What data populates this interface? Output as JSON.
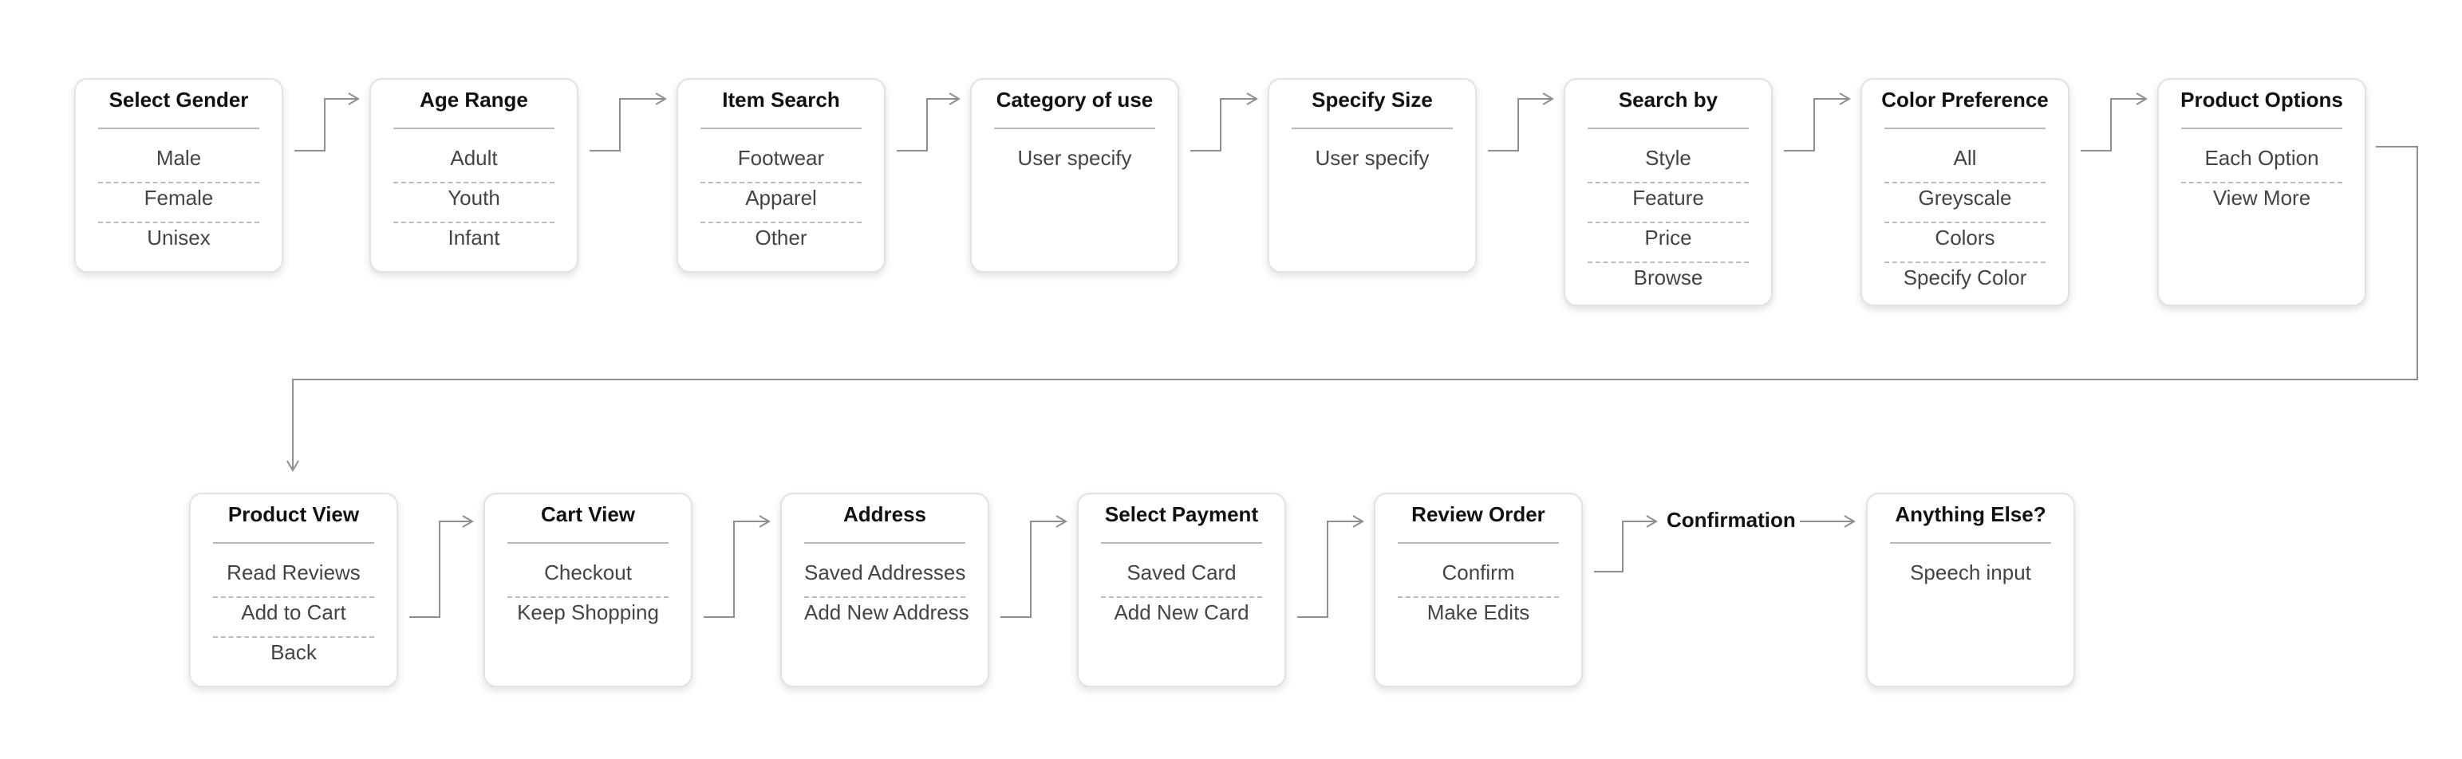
{
  "flow": {
    "row1": [
      {
        "title": "Select Gender",
        "options": [
          "Male",
          "Female",
          "Unisex"
        ]
      },
      {
        "title": "Age Range",
        "options": [
          "Adult",
          "Youth",
          "Infant"
        ]
      },
      {
        "title": "Item Search",
        "options": [
          "Footwear",
          "Apparel",
          "Other"
        ]
      },
      {
        "title": "Category of use",
        "options": [
          "User specify"
        ]
      },
      {
        "title": "Specify Size",
        "options": [
          "User specify"
        ]
      },
      {
        "title": "Search by",
        "options": [
          "Style",
          "Feature",
          "Price",
          "Browse"
        ]
      },
      {
        "title": "Color Preference",
        "options": [
          "All",
          "Greyscale",
          "Colors",
          "Specify Color"
        ]
      },
      {
        "title": "Product Options",
        "options": [
          "Each Option",
          "View More"
        ]
      }
    ],
    "row2": [
      {
        "title": "Product View",
        "options": [
          "Read Reviews",
          "Add to Cart",
          "Back"
        ]
      },
      {
        "title": "Cart View",
        "options": [
          "Checkout",
          "Keep Shopping"
        ]
      },
      {
        "title": "Address",
        "options": [
          "Saved Addresses",
          "Add New Address"
        ]
      },
      {
        "title": "Select Payment",
        "options": [
          "Saved Card",
          "Add New Card"
        ]
      },
      {
        "title": "Review Order",
        "options": [
          "Confirm",
          "Make Edits"
        ]
      },
      {
        "title": "Confirmation",
        "options": []
      },
      {
        "title": "Anything Else?",
        "options": [
          "Speech input"
        ]
      }
    ]
  },
  "colors": {
    "card_border": "#e2e2e2",
    "connector": "#8f8f8f",
    "divider_dashed": "#bcbcbc",
    "title_text": "#111111",
    "option_text": "#444444"
  }
}
